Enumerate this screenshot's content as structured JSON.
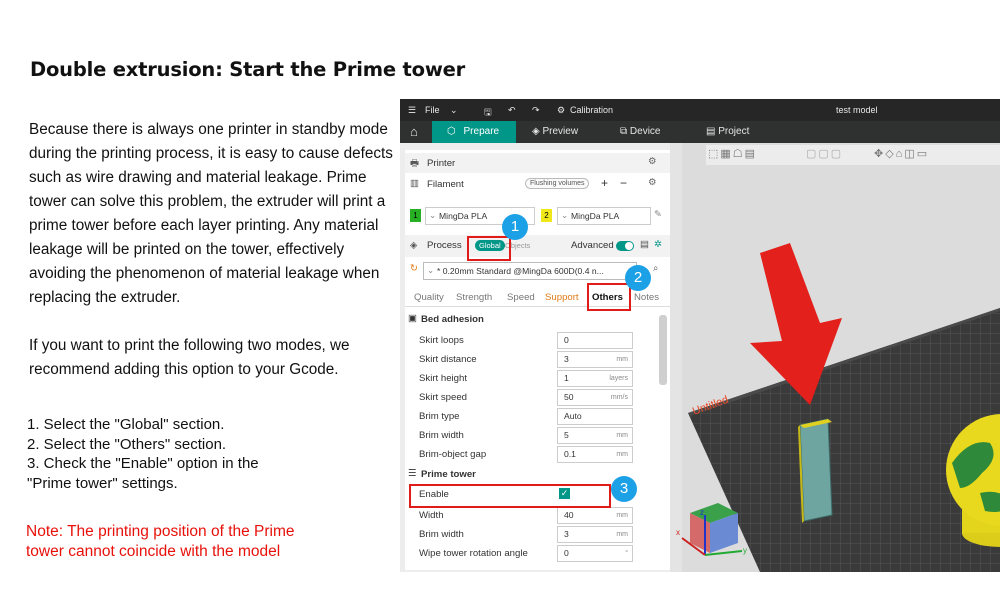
{
  "doc": {
    "title": "Double extrusion: Start the Prime tower",
    "paragraph1": "Because there is always one printer in standby mode during the printing process, it is easy to cause defects such as wire drawing and material leakage. Prime tower can solve this problem, the extruder will print a prime tower before each layer printing. Any material leakage will be printed on the tower, effectively avoiding the phenomenon of material leakage when replacing the extruder.",
    "paragraph2": "If you want to print the following two modes, we recommend adding this option to your Gcode.",
    "step1": "1. Select the \"Global\" section.",
    "step2": "2. Select the \"Others\" section.",
    "step3": "3. Check the \"Enable\" option in the \"Prime tower\" settings.",
    "note": "Note: The printing position of the Prime tower cannot coincide with the model"
  },
  "app": {
    "menu_file": "File",
    "calibration": "Calibration",
    "window_title": "test model",
    "tabs": [
      "Prepare",
      "Preview",
      "Device",
      "Project"
    ],
    "printer_label": "Printer",
    "filament_label": "Filament",
    "flushing_volumes": "Flushing volumes",
    "filaments": [
      {
        "num": "1",
        "name": "MingDa PLA",
        "color": "#27b024"
      },
      {
        "num": "2",
        "name": "MingDa PLA",
        "color": "#f0e81a"
      }
    ],
    "process_label": "Process",
    "global_btn": "Global",
    "objects_btn": "Objects",
    "advanced_label": "Advanced",
    "preset": "* 0.20mm Standard @MingDa 600D(0.4 n...",
    "subtabs": [
      "Quality",
      "Strength",
      "Speed",
      "Support",
      "Others",
      "Notes"
    ],
    "bed_adhesion": "Bed adhesion",
    "bed_fields": [
      {
        "label": "Skirt loops",
        "value": "0",
        "unit": ""
      },
      {
        "label": "Skirt distance",
        "value": "3",
        "unit": "mm"
      },
      {
        "label": "Skirt height",
        "value": "1",
        "unit": "layers"
      },
      {
        "label": "Skirt speed",
        "value": "50",
        "unit": "mm/s"
      },
      {
        "label": "Brim type",
        "value": "Auto",
        "unit": ""
      },
      {
        "label": "Brim width",
        "value": "5",
        "unit": "mm"
      },
      {
        "label": "Brim-object gap",
        "value": "0.1",
        "unit": "mm"
      }
    ],
    "prime_tower": "Prime tower",
    "enable_label": "Enable",
    "enable_checked": true,
    "tower_fields": [
      {
        "label": "Width",
        "value": "40",
        "unit": "mm"
      },
      {
        "label": "Brim width",
        "value": "3",
        "unit": "mm"
      },
      {
        "label": "Wipe tower rotation angle",
        "value": "0",
        "unit": "°"
      }
    ],
    "plate_label": "Untitled",
    "badges": [
      "1",
      "2",
      "3"
    ]
  }
}
